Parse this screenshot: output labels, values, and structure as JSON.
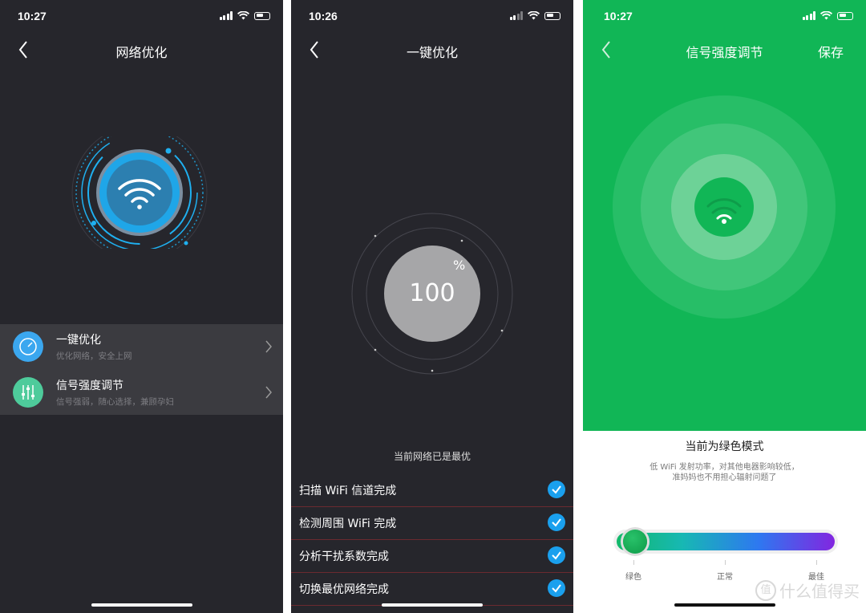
{
  "panel1": {
    "time": "10:27",
    "title": "网络优化",
    "items": [
      {
        "label": "一键优化",
        "sub": "优化网络，安全上网",
        "icon": "speedometer-icon"
      },
      {
        "label": "信号强度调节",
        "sub": "信号强弱，随心选择，兼顾孕妇",
        "icon": "sliders-icon"
      }
    ]
  },
  "panel2": {
    "time": "10:26",
    "title": "一键优化",
    "score": "100",
    "percent": "%",
    "status": "当前网络已是最优",
    "tasks": [
      {
        "label": "扫描 WiFi 信道完成"
      },
      {
        "label": "检测周围 WiFi 完成"
      },
      {
        "label": "分析干扰系数完成"
      },
      {
        "label": "切换最优网络完成"
      }
    ]
  },
  "panel3": {
    "time": "10:27",
    "title": "信号强度调节",
    "save": "保存",
    "mode_title": "当前为绿色模式",
    "mode_desc_1": "低 WiFi 发射功率，对其他电器影响较低，",
    "mode_desc_2": "准妈妈也不用担心辐射问题了",
    "levels": [
      "绿色",
      "正常",
      "最佳"
    ],
    "slider_value": 0
  },
  "watermark": {
    "circle": "值",
    "text": "什么值得买"
  },
  "colors": {
    "dark_bg": "#26262c",
    "accent_blue": "#1aa0ee",
    "green": "#11b656"
  }
}
